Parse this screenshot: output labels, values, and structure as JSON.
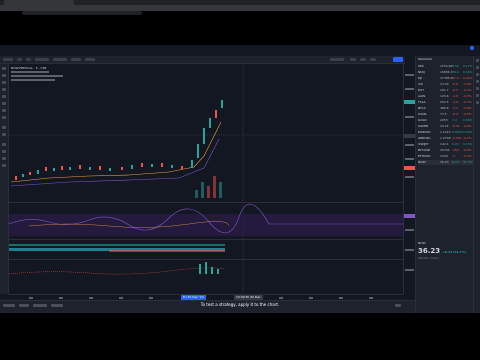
{
  "browser": {
    "tab_title": "NOW 42.5 ▲ +32% Shopzon...",
    "url": "tradingview.com/chart/"
  },
  "toolbar": {
    "symbol": "NOW",
    "interval": "5m",
    "publish_label": "Publish"
  },
  "chart": {
    "legend_title": "NOWVERTICAL · 5 · CSE",
    "current_price_label": "36.23",
    "crosshair_time_label": "Fri 22 Dec '23",
    "session_time_label": "13:30 Fri 22 Dec"
  },
  "watchlist": {
    "title": "Watchlist",
    "rows": [
      {
        "symbol": "SPX",
        "last": "4754.63",
        "chg": "8.56",
        "pct": "0.17%",
        "dir": "up"
      },
      {
        "symbol": "NDQ",
        "last": "16836.7",
        "chg": "26.4",
        "pct": "0.16%",
        "dir": "up"
      },
      {
        "symbol": "DJI",
        "last": "37385.9",
        "chg": "81.9",
        "pct": "0.22%",
        "dir": "dn"
      },
      {
        "symbol": "VIX",
        "last": "13.03",
        "chg": "-0.6",
        "pct": "-4.5%",
        "dir": "dn"
      },
      {
        "symbol": "DXY",
        "last": "101.7",
        "chg": "-0.1",
        "pct": "-0.1%",
        "dir": "dn"
      },
      {
        "symbol": "AAPL",
        "last": "193.6",
        "chg": "-1.0",
        "pct": "-0.5%",
        "dir": "dn"
      },
      {
        "symbol": "TSLA",
        "last": "252.5",
        "chg": "-1.9",
        "pct": "-0.7%",
        "dir": "dn"
      },
      {
        "symbol": "NFLX",
        "last": "486.8",
        "chg": "-3.1",
        "pct": "-0.6%",
        "dir": "dn"
      },
      {
        "symbol": "USOIL",
        "last": "73.5",
        "chg": "-0.4",
        "pct": "-0.5%",
        "dir": "dn"
      },
      {
        "symbol": "GOLD",
        "last": "2053",
        "chg": "7.4",
        "pct": "0.36%",
        "dir": "up"
      },
      {
        "symbol": "SILVER",
        "last": "24.24",
        "chg": "-0.01",
        "pct": "-0.0%",
        "dir": "dn"
      },
      {
        "symbol": "EURUSD",
        "last": "1.1010",
        "chg": "0.0003",
        "pct": "0.03%",
        "dir": "up"
      },
      {
        "symbol": "GBPUSD",
        "last": "1.2708",
        "chg": "-0.001",
        "pct": "-0.1%",
        "dir": "dn"
      },
      {
        "symbol": "USDJPY",
        "last": "142.4",
        "chg": "0.22",
        "pct": "0.15%",
        "dir": "up"
      },
      {
        "symbol": "BTCUSD",
        "last": "43704",
        "chg": "-263",
        "pct": "-0.6%",
        "dir": "dn"
      },
      {
        "symbol": "ETHUSD",
        "last": "2326",
        "chg": "-7",
        "pct": "-0.3%",
        "dir": "dn"
      },
      {
        "symbol": "NOW",
        "last": "36.23",
        "chg": "8.73",
        "pct": "31.7%",
        "dir": "up"
      }
    ]
  },
  "detail": {
    "symbol": "NOW",
    "price": "36.23",
    "change": "+8.73 (31.7%)",
    "market_status": "Market closed"
  },
  "caption": "To test a strategy, apply it to the chart."
}
